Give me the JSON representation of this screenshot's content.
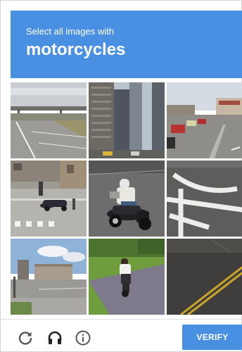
{
  "challenge": {
    "instruction": "Select all images with",
    "target": "motorcycles"
  },
  "tiles": [
    {
      "index": 1,
      "selected": false
    },
    {
      "index": 2,
      "selected": false
    },
    {
      "index": 3,
      "selected": false
    },
    {
      "index": 4,
      "selected": false
    },
    {
      "index": 5,
      "selected": false
    },
    {
      "index": 6,
      "selected": false
    },
    {
      "index": 7,
      "selected": false
    },
    {
      "index": 8,
      "selected": false
    },
    {
      "index": 9,
      "selected": false
    }
  ],
  "footer": {
    "reload_icon": "reload-icon",
    "audio_icon": "headphones-icon",
    "info_icon": "info-icon",
    "verify_label": "VERIFY"
  },
  "colors": {
    "accent": "#4a90e2",
    "icon": "#555555"
  }
}
